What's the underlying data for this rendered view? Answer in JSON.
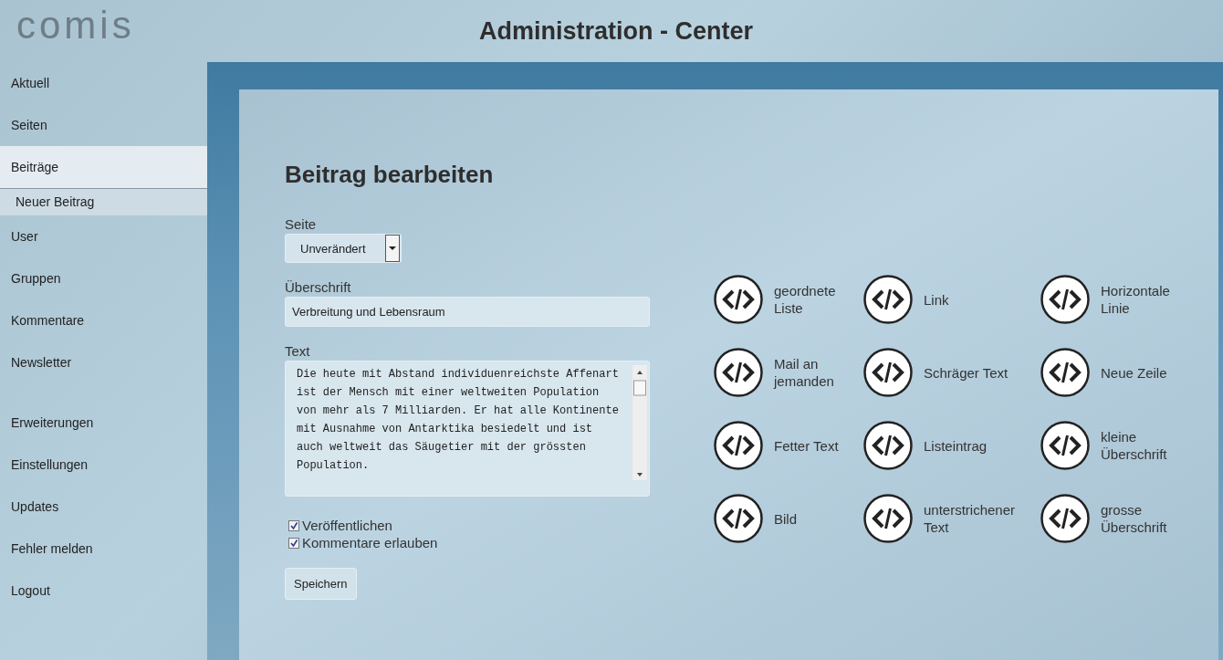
{
  "logo": "comis",
  "header": {
    "title": "Administration - Center"
  },
  "sidebar": {
    "sections": [
      {
        "items": [
          {
            "label": "Aktuell",
            "selected": false
          },
          {
            "label": "Seiten",
            "selected": false
          },
          {
            "label": "Beiträge",
            "selected": true,
            "children": [
              {
                "label": "Neuer Beitrag",
                "selected": false
              }
            ]
          },
          {
            "label": "User",
            "selected": false
          },
          {
            "label": "Gruppen",
            "selected": false
          },
          {
            "label": "Kommentare",
            "selected": false
          },
          {
            "label": "Newsletter",
            "selected": false
          }
        ]
      },
      {
        "items": [
          {
            "label": "Erweiterungen",
            "selected": false
          },
          {
            "label": "Einstellungen",
            "selected": false
          },
          {
            "label": "Updates",
            "selected": false
          },
          {
            "label": "Fehler melden",
            "selected": false
          },
          {
            "label": "Logout",
            "selected": false
          }
        ]
      }
    ]
  },
  "form": {
    "title": "Beitrag bearbeiten",
    "page": {
      "label": "Seite",
      "value": "Unverändert"
    },
    "heading": {
      "label": "Überschrift",
      "value": "Verbreitung und Lebensraum"
    },
    "text": {
      "label": "Text",
      "value": "Die heute mit Abstand individuenreichste Affenart ist der Mensch mit einer weltweiten Population von mehr als 7 Milliarden. Er hat alle Kontinente mit Ausnahme von Antarktika besiedelt und ist auch weltweit das Säugetier mit der grössten Population."
    },
    "checkboxes": [
      {
        "label": "Veröffentlichen",
        "checked": true
      },
      {
        "label": "Kommentare erlauben",
        "checked": true
      }
    ],
    "submit": "Speichern"
  },
  "tags": [
    [
      {
        "label": "geordnete Liste"
      },
      {
        "label": "Mail an jemanden"
      },
      {
        "label": "Fetter Text"
      },
      {
        "label": "Bild"
      }
    ],
    [
      {
        "label": "Link"
      },
      {
        "label": "Schräger Text"
      },
      {
        "label": "Listeintrag"
      },
      {
        "label": "unterstrichener Text"
      }
    ],
    [
      {
        "label": "Horizontale Linie"
      },
      {
        "label": "Neue Zeile"
      },
      {
        "label": "kleine Überschrift"
      },
      {
        "label": "grosse Überschrift"
      }
    ]
  ]
}
